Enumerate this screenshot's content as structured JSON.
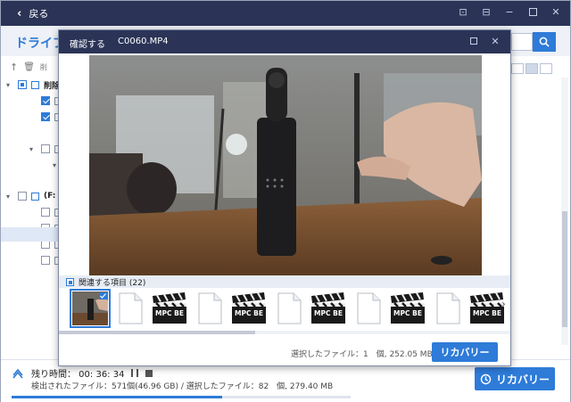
{
  "app": {
    "back_label": "戻る",
    "drive_tab": "ドライブ I"
  },
  "left_panel": {
    "toolbar_label": "削",
    "tree": [
      {
        "label": "削除",
        "checked": "partial",
        "level": 0
      },
      {
        "label": "",
        "checked": "on",
        "level": 1
      },
      {
        "label": "",
        "checked": "on",
        "level": 1
      },
      {
        "label": "",
        "checked": "off",
        "level": 1
      },
      {
        "label": "",
        "checked": "off",
        "level": 2
      },
      {
        "label": "(F:",
        "checked": "off",
        "level": 0
      },
      {
        "label": "",
        "checked": "off",
        "level": 1
      },
      {
        "label": "",
        "checked": "off",
        "level": 1
      },
      {
        "label": "",
        "checked": "off",
        "level": 1
      },
      {
        "label": "",
        "checked": "off",
        "level": 1
      }
    ]
  },
  "bottom": {
    "remaining_label": "残り時間： 00: 36: 34",
    "found_line": "検出されたファイル：571個(46.96 GB) / 選択したファイル：82　個, 279.40 MB",
    "recover_label": "リカバリー",
    "progress": 0.62
  },
  "dialog": {
    "title": "確認する",
    "filename": "C0060.MP4",
    "related_label": "関連する項目 (22)",
    "selected_info": "選択したファイル：1　個, 252.05 MB",
    "recover_label": "リカバリー",
    "thumbnails": [
      "video-frame",
      "blank-doc",
      "mpc-be",
      "blank-doc",
      "mpc-be",
      "blank-doc",
      "mpc-be",
      "blank-doc",
      "mpc-be",
      "blank-doc",
      "mpc-be"
    ],
    "mpc_label": "MPC BE"
  },
  "colors": {
    "titlebar": "#2b3457",
    "accent": "#2e7bd8"
  }
}
